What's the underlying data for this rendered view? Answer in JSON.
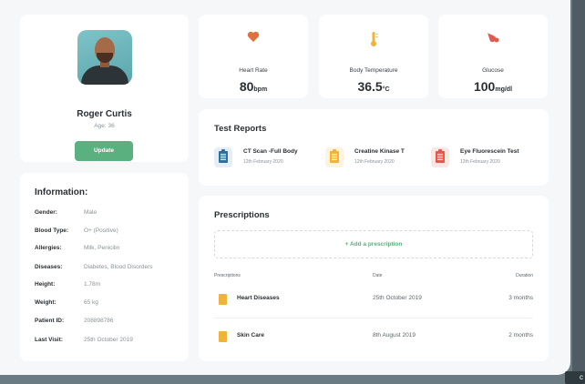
{
  "colors": {
    "accent": "#5ab17f",
    "background": "#f5f7f8",
    "frame": "#6b7b83",
    "heart": "#e0703c",
    "thermo": "#f0b33a",
    "glucose": "#e05a4f",
    "report_blue": "#2f6f9c",
    "report_yellow": "#f0b33a",
    "report_red": "#e05a4f"
  },
  "profile": {
    "name": "Roger Curtis",
    "age": "Age: 36",
    "update_label": "Update"
  },
  "information": {
    "title": "Information:",
    "rows": [
      {
        "label": "Gender:",
        "value": "Male"
      },
      {
        "label": "Blood Type:",
        "value": "O+ (Positive)"
      },
      {
        "label": "Allergies:",
        "value": "Milk, Penicilin"
      },
      {
        "label": "Diseases:",
        "value": "Diabetes, Blood Disorders"
      },
      {
        "label": "Height:",
        "value": "1.78m"
      },
      {
        "label": "Weight:",
        "value": "65 kg"
      },
      {
        "label": "Patient ID:",
        "value": "208898786"
      },
      {
        "label": "Last Visit:",
        "value": "25th October 2019"
      }
    ]
  },
  "vitals": [
    {
      "icon": "heart-icon",
      "label": "Heart Rate",
      "value": "80",
      "unit": "bpm"
    },
    {
      "icon": "thermometer-icon",
      "label": "Body Temperature",
      "value": "36.5",
      "unit": "°C"
    },
    {
      "icon": "blood-drop-icon",
      "label": "Glucose",
      "value": "100",
      "unit": "mg/dl"
    }
  ],
  "test_reports": {
    "title": "Test Reports",
    "items": [
      {
        "name": "CT Scan -Full Body",
        "date": "12th February 2020"
      },
      {
        "name": "Creatine Kinase T",
        "date": "12th February 2020"
      },
      {
        "name": "Eye Fluorescein Test",
        "date": "12th February 2020"
      }
    ]
  },
  "prescriptions": {
    "title": "Prescriptions",
    "add_label": "+ Add a prescription",
    "columns": [
      "Prescriptions",
      "Date",
      "Duration"
    ],
    "rows": [
      {
        "name": "Heart Diseases",
        "date": "25th October 2019",
        "duration": "3 months"
      },
      {
        "name": "Skin Care",
        "date": "8th August 2019",
        "duration": "2 months"
      }
    ]
  },
  "corner_tab": "c"
}
